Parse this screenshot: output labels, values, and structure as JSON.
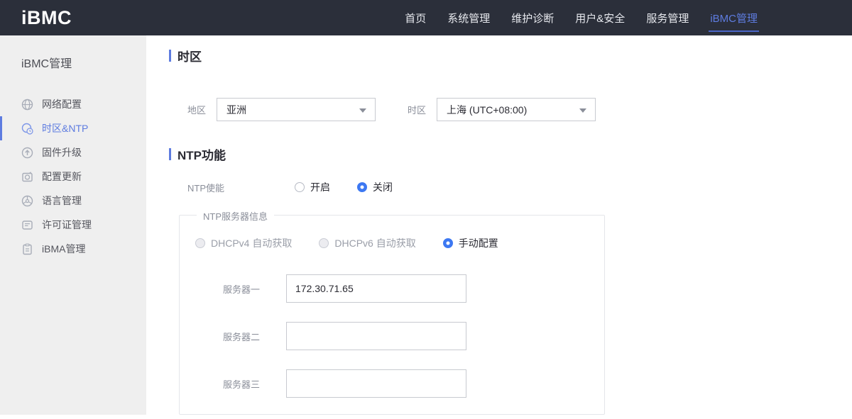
{
  "brand": {
    "logo_text": "iBMC"
  },
  "top_nav": {
    "items": [
      {
        "label": "首页",
        "active": false
      },
      {
        "label": "系统管理",
        "active": false
      },
      {
        "label": "维护诊断",
        "active": false
      },
      {
        "label": "用户&安全",
        "active": false
      },
      {
        "label": "服务管理",
        "active": false
      },
      {
        "label": "iBMC管理",
        "active": true
      }
    ]
  },
  "sidebar": {
    "title": "iBMC管理",
    "items": [
      {
        "label": "网络配置",
        "icon": "network-globe-icon",
        "active": false
      },
      {
        "label": "时区&NTP",
        "icon": "timezone-clock-icon",
        "active": true
      },
      {
        "label": "固件升级",
        "icon": "firmware-upgrade-icon",
        "active": false
      },
      {
        "label": "配置更新",
        "icon": "config-update-icon",
        "active": false
      },
      {
        "label": "语言管理",
        "icon": "language-icon",
        "active": false
      },
      {
        "label": "许可证管理",
        "icon": "license-icon",
        "active": false
      },
      {
        "label": "iBMA管理",
        "icon": "ibma-clipboard-icon",
        "active": false
      }
    ],
    "collapse_icon": "chevron-left-icon"
  },
  "main": {
    "timezone_section": {
      "title": "时区",
      "region_label": "地区",
      "region_value": "亚洲",
      "timezone_label": "时区",
      "timezone_value": "上海 (UTC+08:00)"
    },
    "ntp_section": {
      "title": "NTP功能",
      "enable_label": "NTP使能",
      "enable_options": [
        {
          "label": "开启",
          "selected": false
        },
        {
          "label": "关闭",
          "selected": true
        }
      ],
      "server_group": {
        "legend": "NTP服务器信息",
        "mode_options": [
          {
            "label": "DHCPv4 自动获取",
            "selected": false,
            "disabled": true
          },
          {
            "label": "DHCPv6 自动获取",
            "selected": false,
            "disabled": true
          },
          {
            "label": "手动配置",
            "selected": true,
            "disabled": false
          }
        ],
        "fields": [
          {
            "label": "服务器一",
            "value": "172.30.71.65"
          },
          {
            "label": "服务器二",
            "value": ""
          },
          {
            "label": "服务器三",
            "value": ""
          }
        ]
      }
    }
  },
  "colors": {
    "nav_bg": "#2b2f3a",
    "accent_blue": "#5e7ce0",
    "radio_blue": "#3d78f2",
    "sidebar_bg": "#efefef"
  }
}
